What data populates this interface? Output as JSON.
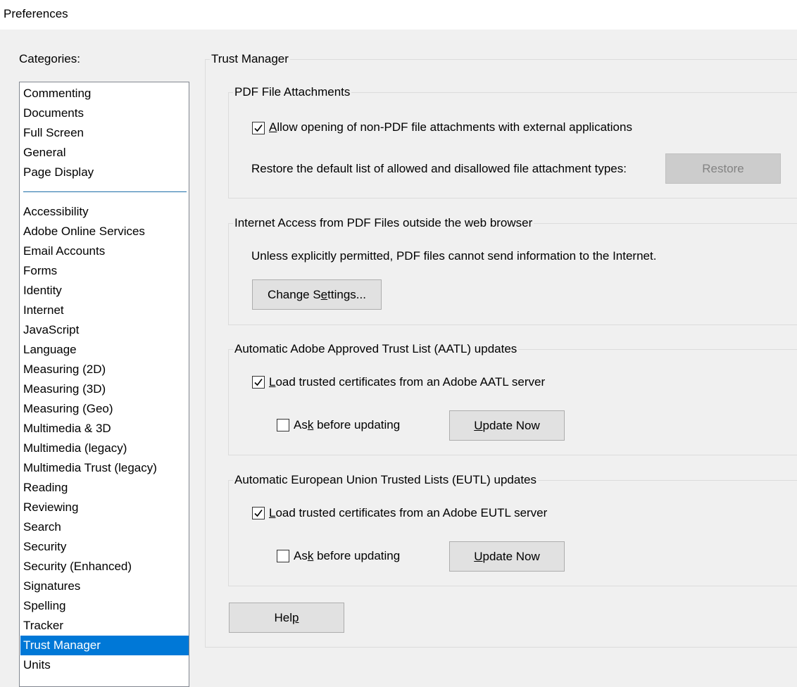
{
  "window": {
    "title": "Preferences"
  },
  "sidebar": {
    "label": "Categories:",
    "items_top": [
      "Commenting",
      "Documents",
      "Full Screen",
      "General",
      "Page Display"
    ],
    "items": [
      "Accessibility",
      "Adobe Online Services",
      "Email Accounts",
      "Forms",
      "Identity",
      "Internet",
      "JavaScript",
      "Language",
      "Measuring (2D)",
      "Measuring (3D)",
      "Measuring (Geo)",
      "Multimedia & 3D",
      "Multimedia (legacy)",
      "Multimedia Trust (legacy)",
      "Reading",
      "Reviewing",
      "Search",
      "Security",
      "Security (Enhanced)",
      "Signatures",
      "Spelling",
      "Tracker",
      "Trust Manager",
      "Units"
    ],
    "selected": "Trust Manager"
  },
  "panel": {
    "title": "Trust Manager"
  },
  "attachments": {
    "title": "PDF File Attachments",
    "allow_checkbox": {
      "checked": true,
      "underline": "A",
      "rest": "llow opening of non-PDF file attachments with external applications"
    },
    "restore_text": "Restore the default list of allowed and disallowed file attachment types:",
    "restore_button": "Restore"
  },
  "internet": {
    "title": "Internet Access from PDF Files outside the web browser",
    "text": "Unless explicitly permitted, PDF files cannot send information to the Internet.",
    "button": {
      "pre": "Change S",
      "u": "e",
      "post": "ttings..."
    }
  },
  "aatl": {
    "title": "Automatic Adobe Approved Trust List (AATL) updates",
    "load_checkbox": {
      "checked": true,
      "underline": "L",
      "rest": "oad trusted certificates from an Adobe AATL server"
    },
    "ask_checkbox": {
      "checked": false,
      "pre": "As",
      "u": "k",
      "post": " before updating"
    },
    "update_button": {
      "u": "U",
      "rest": "pdate Now"
    }
  },
  "eutl": {
    "title": "Automatic European Union Trusted Lists (EUTL) updates",
    "load_checkbox": {
      "checked": true,
      "underline": "L",
      "rest": "oad trusted certificates from an Adobe EUTL server"
    },
    "ask_checkbox": {
      "checked": false,
      "pre": "As",
      "u": "k",
      "post": " before updating"
    },
    "update_button": {
      "u": "U",
      "rest": "pdate Now"
    }
  },
  "help_button": {
    "pre": "Hel",
    "u": "p"
  }
}
